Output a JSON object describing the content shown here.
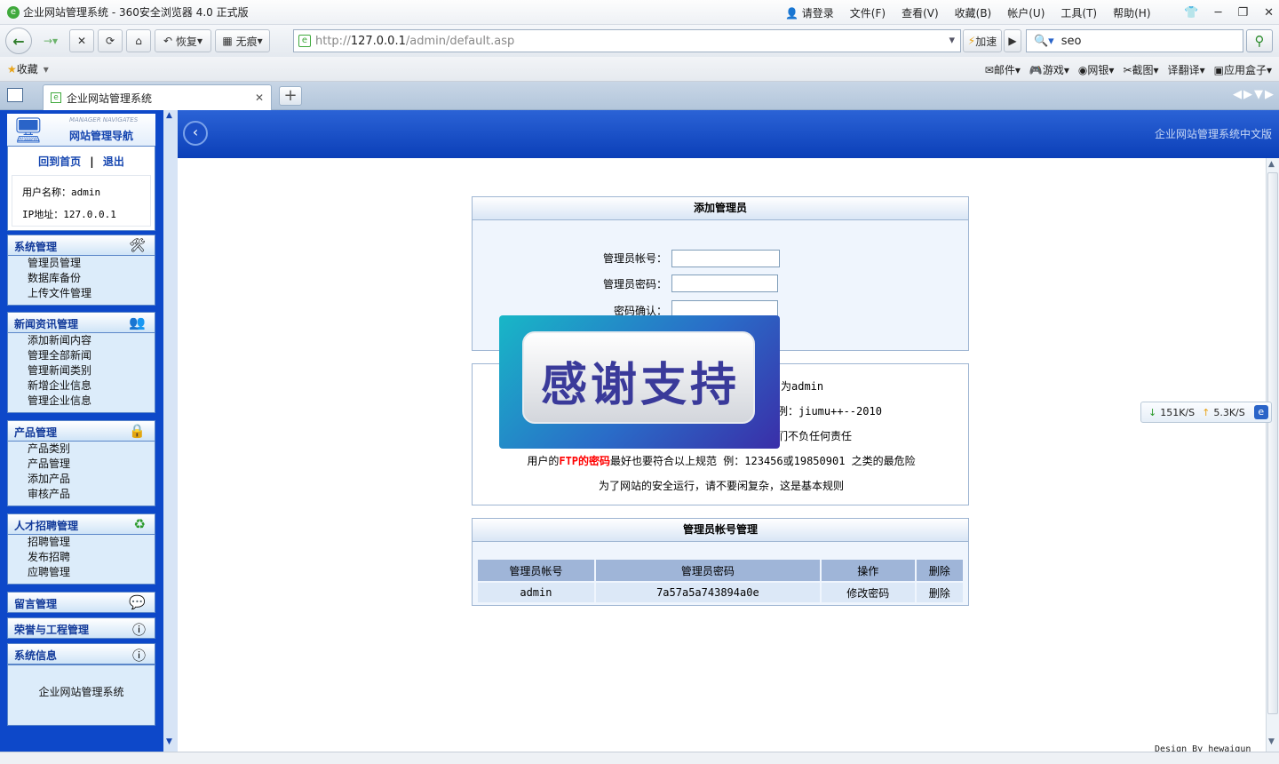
{
  "browser": {
    "window_title": "企业网站管理系统 - 360安全浏览器 4.0 正式版",
    "login_label": "请登录",
    "menus": [
      "文件(F)",
      "查看(V)",
      "收藏(B)",
      "帐户(U)",
      "工具(T)",
      "帮助(H)"
    ],
    "restore_label": "恢复",
    "incognito_label": "无痕",
    "url_prefix": "http://",
    "url_host": "127.0.0.1",
    "url_path": "/admin/default.asp",
    "accelerate_label": "加速",
    "search_value": "seo",
    "favorites_label": "收藏",
    "fav_right_items": [
      "邮件",
      "游戏",
      "网银",
      "截图",
      "翻译",
      "应用盒子"
    ],
    "tab_title": "企业网站管理系统"
  },
  "sidebar": {
    "nav_title_en": "MANAGER NAVIGATES",
    "nav_title": "网站管理导航",
    "home_link": "回到首页",
    "separator": "|",
    "logout_link": "退出",
    "username_label": "用户名称：admin",
    "ip_label": "IP地址：127.0.0.1",
    "groups": [
      {
        "title": "系统管理",
        "items": [
          "管理员管理",
          "数据库备份",
          "上传文件管理"
        ]
      },
      {
        "title": "新闻资讯管理",
        "items": [
          "添加新闻内容",
          "管理全部新闻",
          "管理新闻类别",
          "新增企业信息",
          "管理企业信息"
        ]
      },
      {
        "title": "产品管理",
        "items": [
          "产品类别",
          "产品管理",
          "添加产品",
          "审核产品"
        ]
      },
      {
        "title": "人才招聘管理",
        "items": [
          "招聘管理",
          "发布招聘",
          "应聘管理"
        ]
      },
      {
        "title": "留言管理",
        "items": []
      },
      {
        "title": "荣誉与工程管理",
        "items": []
      },
      {
        "title": "系统信息",
        "items": []
      }
    ],
    "footer_text": "企业网站管理系统"
  },
  "banner": {
    "right_text": "企业网站管理系统中文版"
  },
  "add_admin": {
    "title": "添加管理员",
    "account_label": "管理员帐号：",
    "password_label": "管理员密码：",
    "confirm_label": "密码确认："
  },
  "notes": {
    "line1_visible": "为admin",
    "line2_visible": "例：jiumu++--2010",
    "line3_visible": "们不负任何责任",
    "line4_pre": "用户的",
    "line4_highlight": "FTP的密码",
    "line4_post": "最好也要符合以上规范 例：123456或19850901 之类的最危险",
    "line5": "为了网站的安全运行，请不要闲复杂，这是基本规则"
  },
  "accounts": {
    "title": "管理员帐号管理",
    "headers": [
      "管理员帐号",
      "管理员密码",
      "操作",
      "删除"
    ],
    "rows": [
      {
        "account": "admin",
        "password": "7a57a5a743894a0e",
        "action": "修改密码",
        "delete": "删除"
      }
    ]
  },
  "overlay": {
    "text": "感谢支持"
  },
  "speed": {
    "down": "151K/S",
    "up": "5.3K/S"
  },
  "footer": {
    "design_credit": "Design By hewaiqun"
  },
  "colors": {
    "frame_blue": "#0d48c9",
    "panel_bg": "#eff5fd",
    "highlight_red": "#ff0000"
  }
}
